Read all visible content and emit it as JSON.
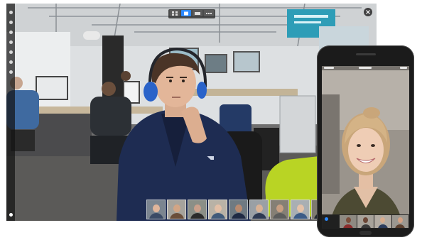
{
  "colors": {
    "accent": "#2b89ff",
    "desktop_frame": "#141414",
    "phone_body": "#1b1b1b",
    "hoodie_navy": "#1e2c52",
    "headphones_blue": "#2a63c9"
  },
  "icons": {
    "close": "close-icon",
    "grid_view": "grid-view-icon",
    "speaker_view": "speaker-view-icon",
    "toolbar_tools": "toolbar-icon"
  },
  "desktop": {
    "participant_thumbnail_count": 10,
    "active_view": "speaker-view"
  },
  "phone": {
    "participant_thumbnail_count": 4
  }
}
